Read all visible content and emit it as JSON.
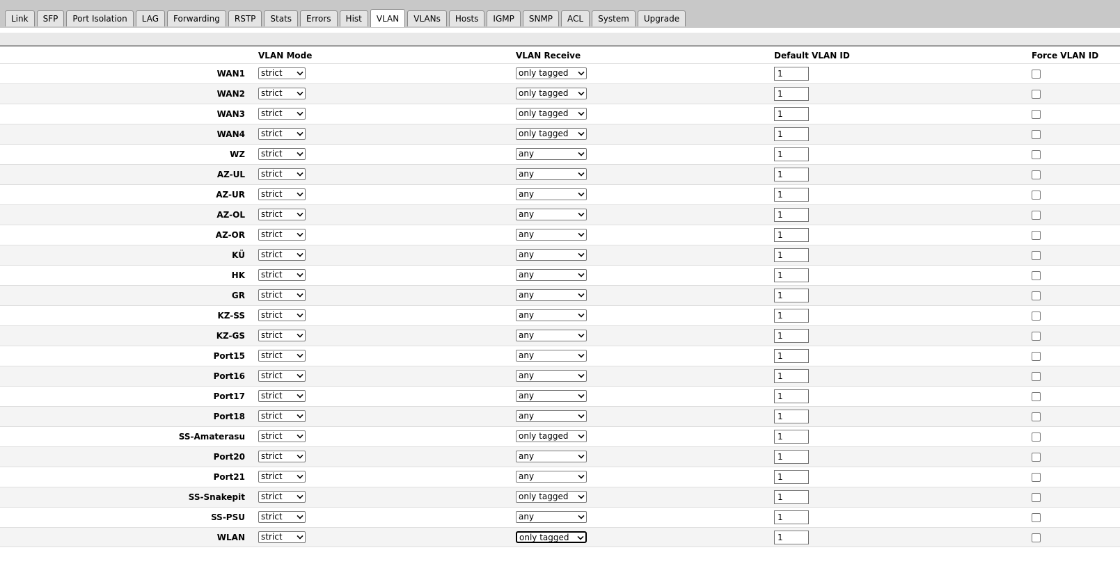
{
  "tabs": [
    {
      "label": "Link",
      "active": false
    },
    {
      "label": "SFP",
      "active": false
    },
    {
      "label": "Port Isolation",
      "active": false
    },
    {
      "label": "LAG",
      "active": false
    },
    {
      "label": "Forwarding",
      "active": false
    },
    {
      "label": "RSTP",
      "active": false
    },
    {
      "label": "Stats",
      "active": false
    },
    {
      "label": "Errors",
      "active": false
    },
    {
      "label": "Hist",
      "active": false
    },
    {
      "label": "VLAN",
      "active": true
    },
    {
      "label": "VLANs",
      "active": false
    },
    {
      "label": "Hosts",
      "active": false
    },
    {
      "label": "IGMP",
      "active": false
    },
    {
      "label": "SNMP",
      "active": false
    },
    {
      "label": "ACL",
      "active": false
    },
    {
      "label": "System",
      "active": false
    },
    {
      "label": "Upgrade",
      "active": false
    }
  ],
  "columns": {
    "mode": "VLAN Mode",
    "receive": "VLAN Receive",
    "default_id": "Default VLAN ID",
    "force": "Force VLAN ID"
  },
  "ports": [
    {
      "name": "WAN1",
      "mode": "strict",
      "receive": "only tagged",
      "default_id": "1",
      "force": false
    },
    {
      "name": "WAN2",
      "mode": "strict",
      "receive": "only tagged",
      "default_id": "1",
      "force": false
    },
    {
      "name": "WAN3",
      "mode": "strict",
      "receive": "only tagged",
      "default_id": "1",
      "force": false
    },
    {
      "name": "WAN4",
      "mode": "strict",
      "receive": "only tagged",
      "default_id": "1",
      "force": false
    },
    {
      "name": "WZ",
      "mode": "strict",
      "receive": "any",
      "default_id": "1",
      "force": false
    },
    {
      "name": "AZ-UL",
      "mode": "strict",
      "receive": "any",
      "default_id": "1",
      "force": false
    },
    {
      "name": "AZ-UR",
      "mode": "strict",
      "receive": "any",
      "default_id": "1",
      "force": false
    },
    {
      "name": "AZ-OL",
      "mode": "strict",
      "receive": "any",
      "default_id": "1",
      "force": false
    },
    {
      "name": "AZ-OR",
      "mode": "strict",
      "receive": "any",
      "default_id": "1",
      "force": false
    },
    {
      "name": "KÜ",
      "mode": "strict",
      "receive": "any",
      "default_id": "1",
      "force": false
    },
    {
      "name": "HK",
      "mode": "strict",
      "receive": "any",
      "default_id": "1",
      "force": false
    },
    {
      "name": "GR",
      "mode": "strict",
      "receive": "any",
      "default_id": "1",
      "force": false
    },
    {
      "name": "KZ-SS",
      "mode": "strict",
      "receive": "any",
      "default_id": "1",
      "force": false
    },
    {
      "name": "KZ-GS",
      "mode": "strict",
      "receive": "any",
      "default_id": "1",
      "force": false
    },
    {
      "name": "Port15",
      "mode": "strict",
      "receive": "any",
      "default_id": "1",
      "force": false
    },
    {
      "name": "Port16",
      "mode": "strict",
      "receive": "any",
      "default_id": "1",
      "force": false
    },
    {
      "name": "Port17",
      "mode": "strict",
      "receive": "any",
      "default_id": "1",
      "force": false
    },
    {
      "name": "Port18",
      "mode": "strict",
      "receive": "any",
      "default_id": "1",
      "force": false
    },
    {
      "name": "SS-Amaterasu",
      "mode": "strict",
      "receive": "only tagged",
      "default_id": "1",
      "force": false
    },
    {
      "name": "Port20",
      "mode": "strict",
      "receive": "any",
      "default_id": "1",
      "force": false
    },
    {
      "name": "Port21",
      "mode": "strict",
      "receive": "any",
      "default_id": "1",
      "force": false
    },
    {
      "name": "SS-Snakepit",
      "mode": "strict",
      "receive": "only tagged",
      "default_id": "1",
      "force": false
    },
    {
      "name": "SS-PSU",
      "mode": "strict",
      "receive": "any",
      "default_id": "1",
      "force": false
    },
    {
      "name": "WLAN",
      "mode": "strict",
      "receive": "only tagged",
      "default_id": "1",
      "force": false,
      "focused": true
    }
  ]
}
